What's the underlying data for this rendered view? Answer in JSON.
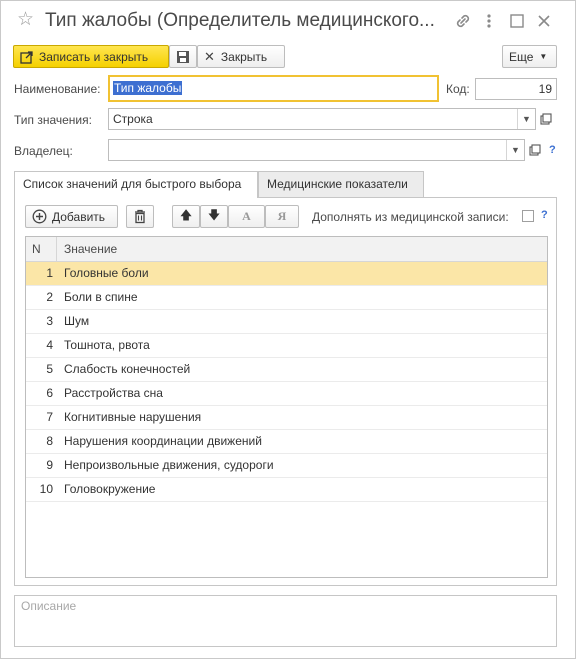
{
  "window": {
    "title": "Тип жалобы (Определитель медицинского..."
  },
  "toolbar": {
    "save_close_label": "Записать и закрыть",
    "close_label": "Закрыть",
    "more_label": "Еще"
  },
  "form": {
    "name_label": "Наименование:",
    "name_value": "Тип жалобы",
    "code_label": "Код:",
    "code_value": "19",
    "value_type_label": "Тип значения:",
    "value_type_value": "Строка",
    "owner_label": "Владелец:",
    "owner_value": "",
    "help_glyph": "?"
  },
  "tabs": [
    {
      "label": "Список значений для быстрого выбора",
      "active": true
    },
    {
      "label": "Медицинские показатели",
      "active": false
    }
  ],
  "list_toolbar": {
    "add_label": "Добавить",
    "format_a_glyph": "A",
    "format_ya_glyph": "Я",
    "supplement_label": "Дополнять из медицинской записи:",
    "supplement_checked": false,
    "help_glyph": "?"
  },
  "table": {
    "columns": [
      "N",
      "Значение"
    ],
    "rows": [
      {
        "n": "1",
        "value": "Головные боли",
        "selected": true
      },
      {
        "n": "2",
        "value": "Боли в спине"
      },
      {
        "n": "3",
        "value": "Шум"
      },
      {
        "n": "4",
        "value": "Тошнота, рвота"
      },
      {
        "n": "5",
        "value": "Слабость конечностей"
      },
      {
        "n": "6",
        "value": "Расстройства сна"
      },
      {
        "n": "7",
        "value": "Когнитивные нарушения"
      },
      {
        "n": "8",
        "value": "Нарушения координации движений"
      },
      {
        "n": "9",
        "value": "Непроизвольные движения, судороги"
      },
      {
        "n": "10",
        "value": "Головокружение"
      }
    ]
  },
  "description": {
    "placeholder": "Описание"
  },
  "colors": {
    "primary_button": "#f5d100",
    "selected_row": "#fbe6a7",
    "focus_border": "#f1c232",
    "text_selection": "#3d6fd1",
    "help": "#3b6fd1"
  },
  "icons": [
    "star-icon",
    "link-icon",
    "more-vertical-icon",
    "maximize-icon",
    "close-icon",
    "save-close-icon",
    "save-icon",
    "close-x-icon",
    "dropdown-icon",
    "open-icon",
    "plus-circle-icon",
    "trash-icon",
    "arrow-up-icon",
    "arrow-down-icon"
  ]
}
